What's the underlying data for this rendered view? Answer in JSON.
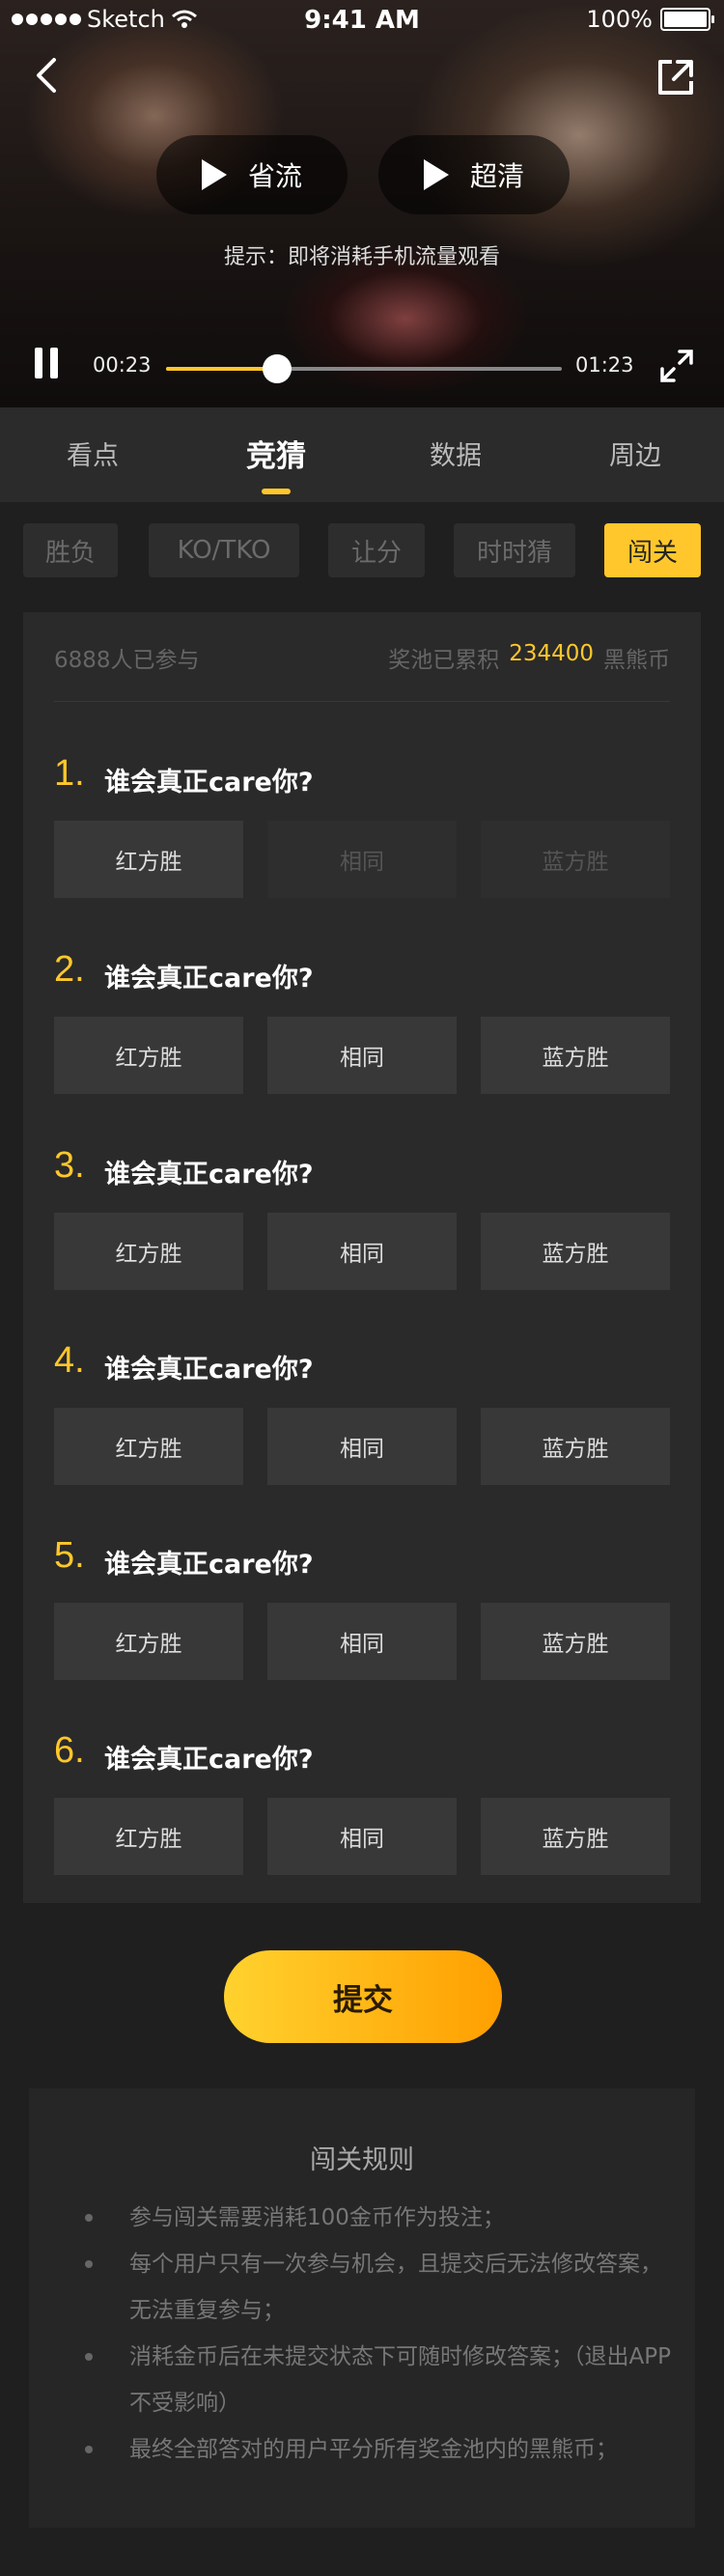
{
  "status_bar": {
    "carrier": "Sketch",
    "time": "9:41 AM",
    "battery": "100%"
  },
  "video": {
    "quality_options": [
      "省流",
      "超清"
    ],
    "tip": "提示：即将消耗手机流量观看",
    "current_time": "00:23",
    "total_time": "01:23",
    "progress_fraction": 0.28
  },
  "tabs": [
    "看点",
    "竞猜",
    "数据",
    "周边"
  ],
  "active_tab": "竞猜",
  "sub_tabs": [
    "胜负",
    "KO/TKO",
    "让分",
    "时时猜",
    "闯关"
  ],
  "active_sub_tab": "闯关",
  "quiz": {
    "joined": "6888人已参与",
    "pool_label": "奖池已累积",
    "pool_amount": "234400",
    "pool_unit": "黑熊币",
    "questions": [
      {
        "num": "1.",
        "text": "谁会真正care你?",
        "options": [
          "红方胜",
          "相同",
          "蓝方胜"
        ]
      },
      {
        "num": "2.",
        "text": "谁会真正care你?",
        "options": [
          "红方胜",
          "相同",
          "蓝方胜"
        ]
      },
      {
        "num": "3.",
        "text": "谁会真正care你?",
        "options": [
          "红方胜",
          "相同",
          "蓝方胜"
        ]
      },
      {
        "num": "4.",
        "text": "谁会真正care你?",
        "options": [
          "红方胜",
          "相同",
          "蓝方胜"
        ]
      },
      {
        "num": "5.",
        "text": "谁会真正care你?",
        "options": [
          "红方胜",
          "相同",
          "蓝方胜"
        ]
      },
      {
        "num": "6.",
        "text": "谁会真正care你?",
        "options": [
          "红方胜",
          "相同",
          "蓝方胜"
        ]
      }
    ],
    "submit": "提交"
  },
  "rules": {
    "title": "闯关规则",
    "items": [
      "参与闯关需要消耗100金币作为投注；",
      "每个用户只有一次参与机会，且提交后无法修改答案，无法重复参与；",
      "消耗金币后在未提交状态下可随时修改答案；（退出APP不受影响）",
      "最终全部答对的用户平分所有奖金池内的黑熊币；"
    ]
  },
  "colors": {
    "accent": "#ffc72b",
    "background": "#1f1f1f",
    "card": "#2a2a2a"
  }
}
